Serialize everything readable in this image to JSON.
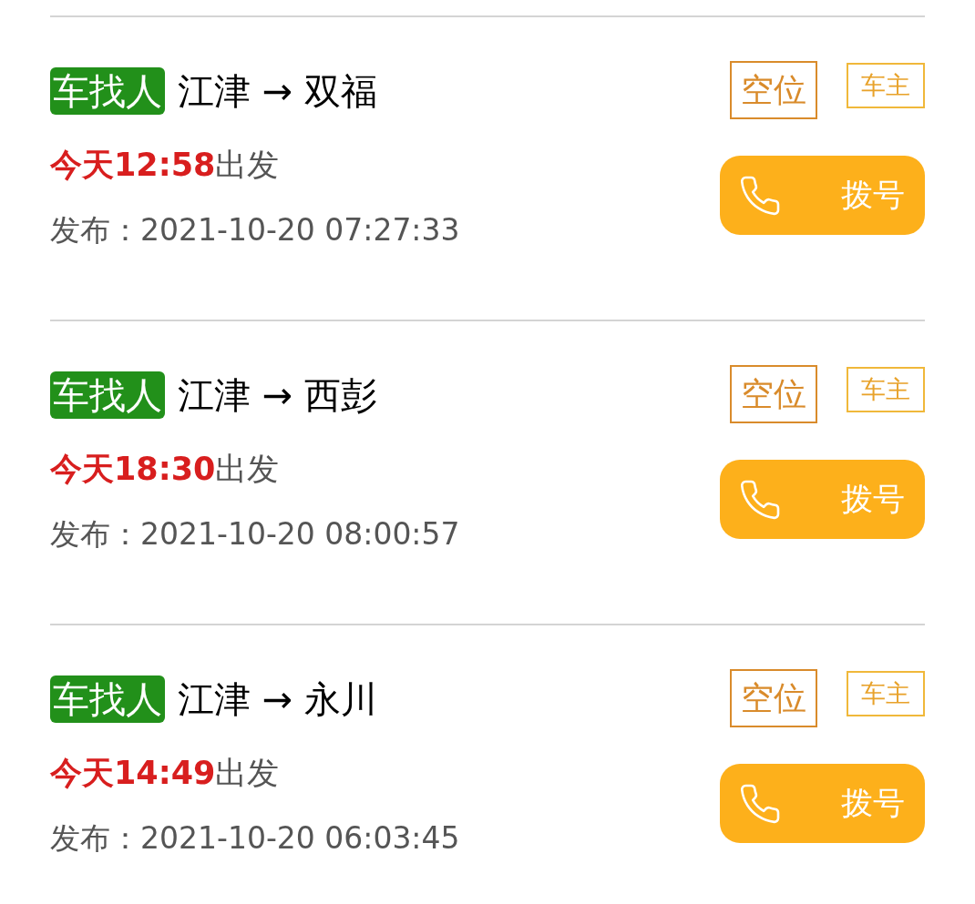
{
  "rides": [
    {
      "tag": "车找人",
      "route": "江津 → 双福",
      "departure": "**今天12:58**出发",
      "published": "发布：2021-10-20 07:27:33",
      "badges": [
        "空位",
        "车主"
      ],
      "call_button": "拨号"
    },
    {
      "tag": "车找人",
      "route": "江津 → 西彭",
      "departure": "**今天18:30**出发",
      "published": "发布：2021-10-20 08:00:57",
      "badges": [
        "空位",
        "车主"
      ],
      "call_button": "拨号"
    },
    {
      "tag": "车找人",
      "route": "江津 → 永川",
      "departure": "**今天14:49**出发",
      "published": "发布：2021-10-20 06:03:45",
      "badges": [
        "空位",
        "车主"
      ],
      "call_button": "拨号"
    }
  ]
}
